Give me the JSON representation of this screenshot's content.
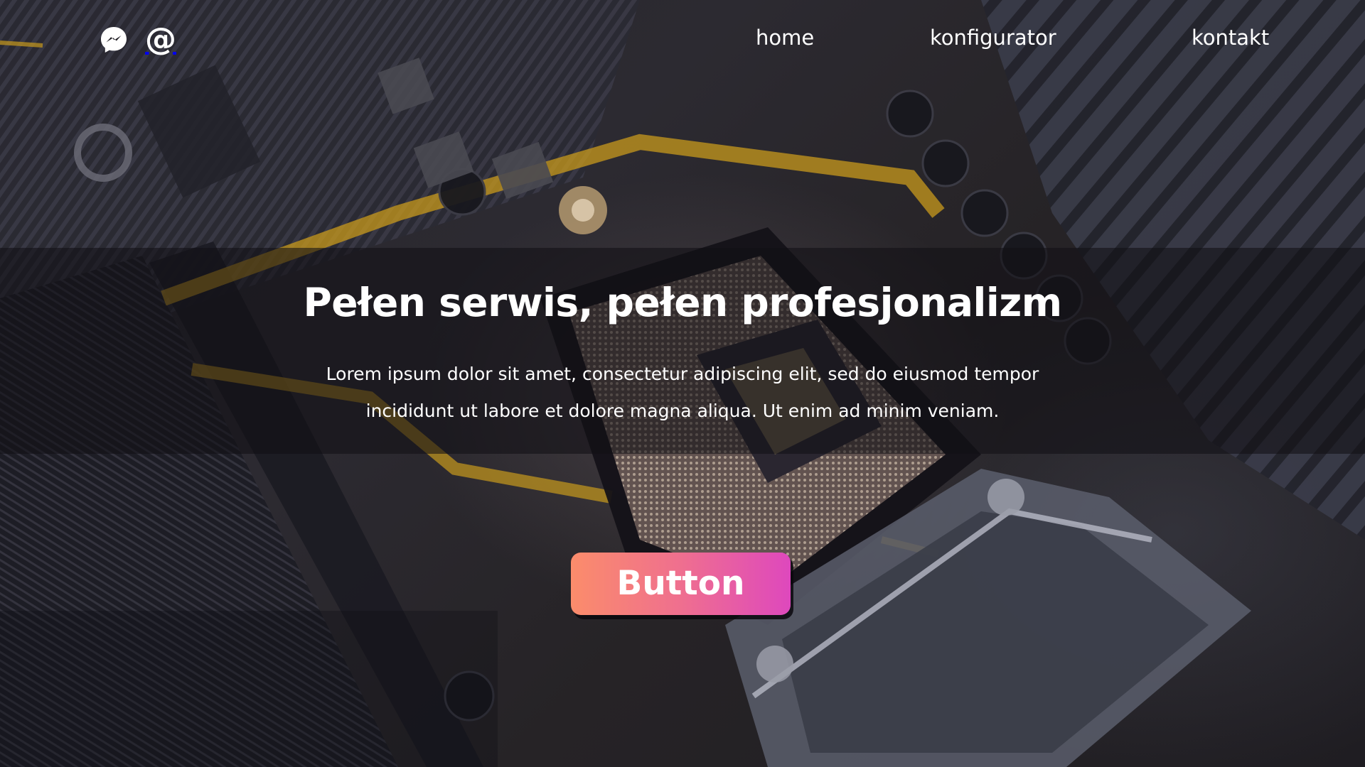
{
  "nav": {
    "social": [
      {
        "icon": "messenger-icon",
        "label": "Messenger"
      },
      {
        "icon": "at-sign-icon",
        "glyph": "@"
      }
    ],
    "links": [
      "home",
      "konfigurator",
      "kontakt"
    ]
  },
  "hero": {
    "title": "Pełen serwis, pełen profesjonalizm",
    "text": "Lorem ipsum dolor sit amet, consectetur adipiscing elit, sed do eiusmod tempor incididunt ut labore et dolore magna aliqua. Ut enim ad minim veniam.",
    "button_label": "Button"
  },
  "colors": {
    "button_gradient_start": "#fb8c6b",
    "button_gradient_mid": "#ef6f8f",
    "button_gradient_end": "#de48bd",
    "band_overlay": "#121014",
    "text": "#ffffff",
    "pcb_trace_yellow": "#d4a21a"
  }
}
